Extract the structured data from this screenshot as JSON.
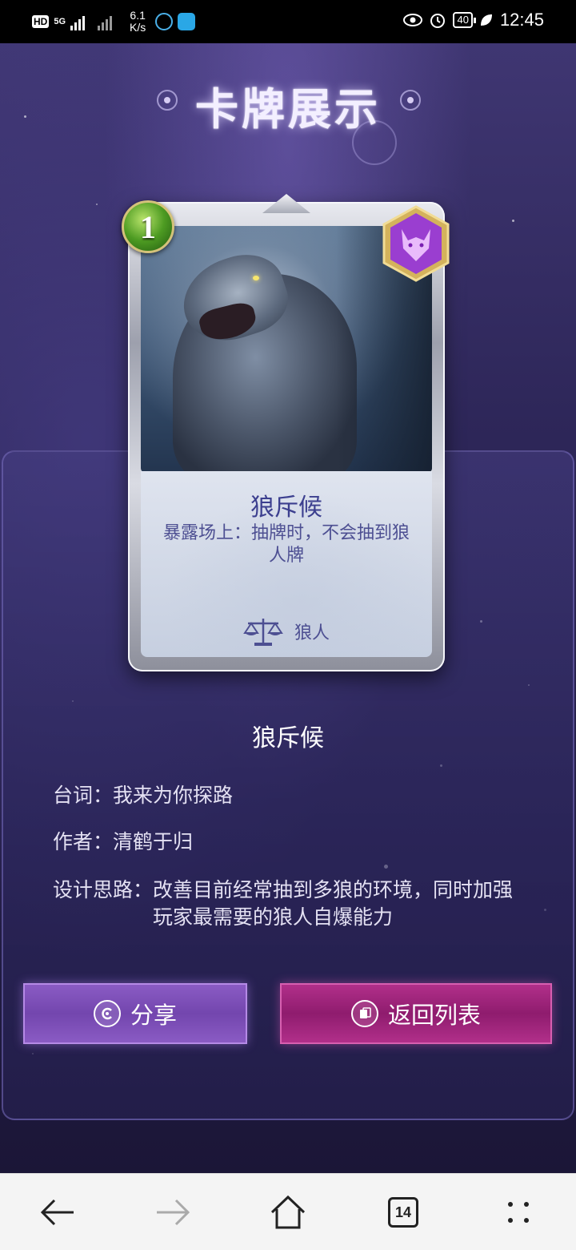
{
  "status_bar": {
    "hd_label": "HD",
    "network_label": "5G",
    "net_speed_value": "6.1",
    "net_speed_unit": "K/s",
    "battery": "40",
    "time": "12:45"
  },
  "page": {
    "title": "卡牌展示"
  },
  "card": {
    "cost": "1",
    "name": "狼斥候",
    "description": "暴露场上：抽牌时，不会抽到狼人牌",
    "type": "狼人",
    "cost_color": "#4d9b22",
    "faction_color": "#9a3ed0"
  },
  "details": {
    "name": "狼斥候",
    "line_label": "台词：",
    "line_value": "我来为你探路",
    "author_label": "作者：",
    "author_value": "清鹤于归",
    "design_label": "设计思路：",
    "design_value": "改善目前经常抽到多狼的环境，同时加强玩家最需要的狼人自爆能力"
  },
  "buttons": {
    "share_label": "分享",
    "back_label": "返回列表"
  },
  "browser_nav": {
    "tab_count": "14",
    "icons": [
      "back-arrow-icon",
      "forward-arrow-icon",
      "home-icon",
      "tabs-icon",
      "more-icon"
    ]
  },
  "colors": {
    "share_button": "#7a4db4",
    "back_button": "#a2257e",
    "card_text": "#3c3f8f"
  }
}
